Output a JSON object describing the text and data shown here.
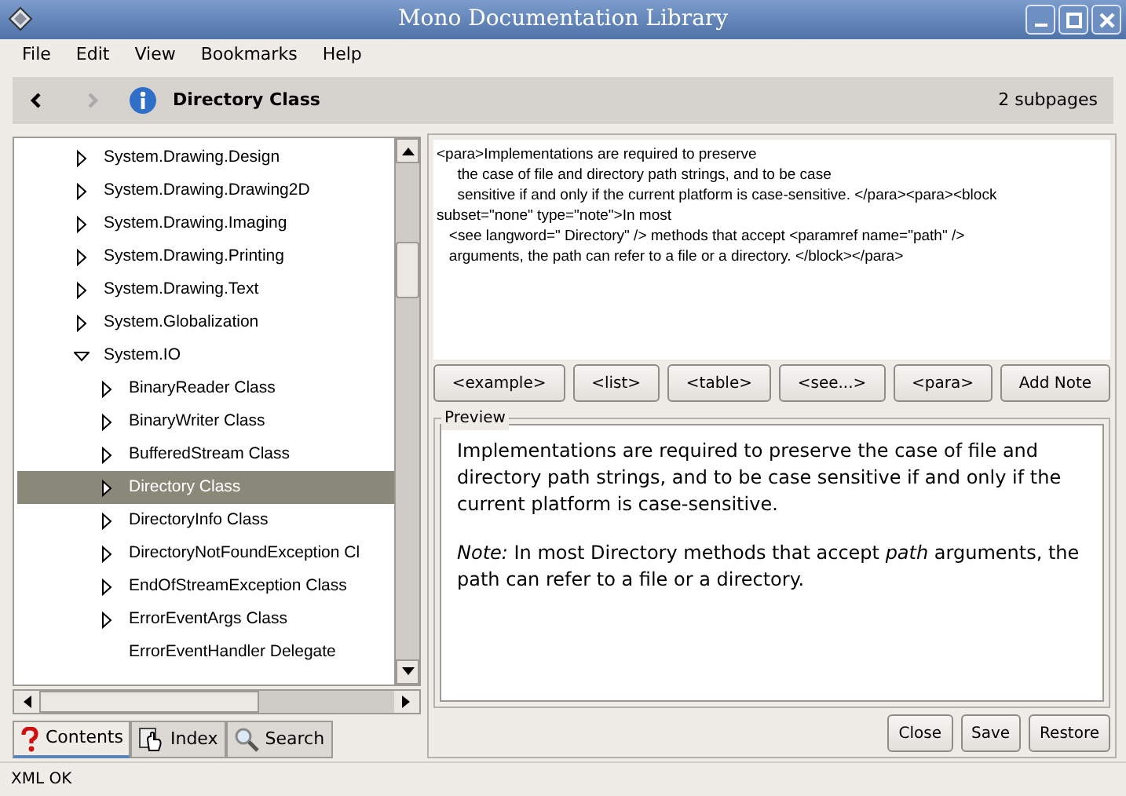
{
  "window": {
    "title": "Mono Documentation Library"
  },
  "menu": [
    "File",
    "Edit",
    "View",
    "Bookmarks",
    "Help"
  ],
  "navigation": {
    "back_disabled": false,
    "forward_disabled": true,
    "title": "Directory Class",
    "subpages": "2 subpages"
  },
  "tree": [
    {
      "label": "System.Drawing.Design",
      "kind": "branch",
      "expanded": false,
      "selected": false
    },
    {
      "label": "System.Drawing.Drawing2D",
      "kind": "branch",
      "expanded": false,
      "selected": false
    },
    {
      "label": "System.Drawing.Imaging",
      "kind": "branch",
      "expanded": false,
      "selected": false
    },
    {
      "label": "System.Drawing.Printing",
      "kind": "branch",
      "expanded": false,
      "selected": false
    },
    {
      "label": "System.Drawing.Text",
      "kind": "branch",
      "expanded": false,
      "selected": false
    },
    {
      "label": "System.Globalization",
      "kind": "branch",
      "expanded": false,
      "selected": false
    },
    {
      "label": "System.IO",
      "kind": "branch",
      "expanded": true,
      "selected": false,
      "children": [
        {
          "label": "BinaryReader Class",
          "kind": "branch",
          "expanded": false,
          "selected": false
        },
        {
          "label": "BinaryWriter Class",
          "kind": "branch",
          "expanded": false,
          "selected": false
        },
        {
          "label": "BufferedStream Class",
          "kind": "branch",
          "expanded": false,
          "selected": false
        },
        {
          "label": "Directory Class",
          "kind": "branch",
          "expanded": false,
          "selected": true
        },
        {
          "label": "DirectoryInfo Class",
          "kind": "branch",
          "expanded": false,
          "selected": false
        },
        {
          "label": "DirectoryNotFoundException Cl",
          "kind": "branch",
          "expanded": false,
          "selected": false
        },
        {
          "label": "EndOfStreamException Class",
          "kind": "branch",
          "expanded": false,
          "selected": false
        },
        {
          "label": "ErrorEventArgs Class",
          "kind": "branch",
          "expanded": false,
          "selected": false
        },
        {
          "label": "ErrorEventHandler Delegate",
          "kind": "leaf",
          "selected": false
        }
      ]
    }
  ],
  "side_tabs": [
    {
      "label": "Contents",
      "selected": true
    },
    {
      "label": "Index",
      "selected": false
    },
    {
      "label": "Search",
      "selected": false
    }
  ],
  "editor": {
    "lines": [
      "<para>Implementations are required to preserve",
      "     the case of file and directory path strings, and to be case",
      "     sensitive if and only if the current platform is case-sensitive. </para><para><block",
      "subset=\"none\" type=\"note\">In most",
      "   <see langword=\" Directory\" /> methods that accept <paramref name=\"path\" />",
      "   arguments, the path can refer to a file or a directory. </block></para>"
    ]
  },
  "insert_buttons": [
    "<example>",
    "<list>",
    "<table>",
    "<see...>",
    "<para>",
    "Add Note"
  ],
  "preview": {
    "label": "Preview",
    "paragraphs": [
      "Implementations are required to preserve the case of file and directory path strings, and to be case sensitive if and only if the current platform is case-sensitive.",
      "*Note:*  In most Directory methods that accept *path* arguments, the path can refer to a file or a directory."
    ]
  },
  "action_buttons": [
    "Close",
    "Save",
    "Restore"
  ],
  "status_bar": "XML OK"
}
